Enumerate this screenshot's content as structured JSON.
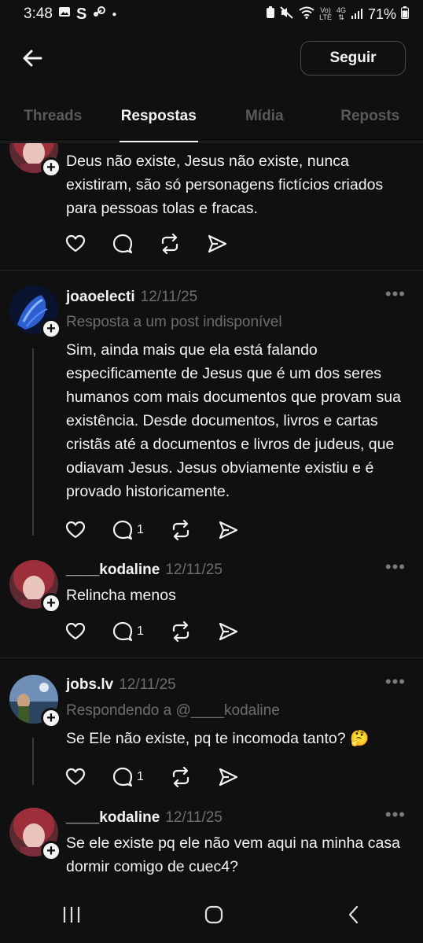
{
  "status": {
    "time": "3:48",
    "battery": "71%",
    "network_top": "Vo)",
    "network_bottom": "LTE",
    "gen_top": "4G"
  },
  "header": {
    "follow_label": "Seguir"
  },
  "tabs": [
    {
      "label": "Threads"
    },
    {
      "label": "Respostas"
    },
    {
      "label": "Mídia"
    },
    {
      "label": "Reposts"
    }
  ],
  "posts": [
    {
      "text": "Deus não existe, Jesus não existe, nunca existiram, são só personagens fictícios criados para pessoas tolas e fracas."
    },
    {
      "username": "joaoelecti",
      "date": "12/11/25",
      "context": "Resposta a um post indisponível",
      "text": "Sim, ainda mais que ela está falando especificamente de Jesus que é um dos seres humanos com mais documentos que provam sua existência. Desde documentos, livros e cartas cristãs até a documentos e livros de judeus, que odiavam Jesus. Jesus obviamente existiu e é provado historicamente.",
      "replies": "1"
    },
    {
      "username": "____kodaline",
      "date": "12/11/25",
      "text": "Relincha menos",
      "replies": "1"
    },
    {
      "username": "jobs.lv",
      "date": "12/11/25",
      "context": "Respondendo a @____kodaline",
      "text": "Se Ele não existe, pq te incomoda tanto? 🤔",
      "replies": "1"
    },
    {
      "username": "____kodaline",
      "date": "12/11/25",
      "text": "Se ele existe pq ele não vem aqui na minha casa dormir comigo de cuec4?"
    }
  ]
}
